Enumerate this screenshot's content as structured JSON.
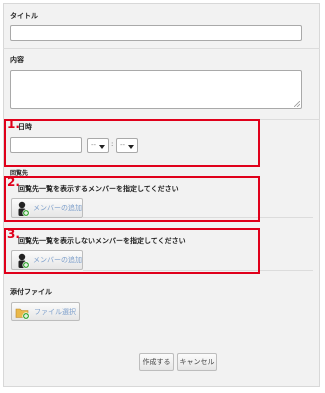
{
  "form": {
    "title_label": "タイトル",
    "content_label": "内容",
    "datetime_label": "日時",
    "hour_value": "--",
    "minute_value": "--",
    "time_separator": ":",
    "recipients_label": "回覧先",
    "show_members_label": "回覧先一覧を表示するメンバーを指定してください",
    "hide_members_label": "回覧先一覧を表示しないメンバーを指定してください",
    "add_member_button": "メンバーの追加",
    "attachment_label": "添付ファイル",
    "file_select_button": "ファイル選択",
    "create_button": "作成する",
    "cancel_button": "キャンセル"
  },
  "annotations": {
    "marker_1": "1.",
    "marker_2": "2.",
    "marker_3": "3.",
    "highlight_color": "#e0001b"
  },
  "icons": [
    "person-add-icon",
    "folder-add-icon",
    "chevron-down-icon"
  ]
}
